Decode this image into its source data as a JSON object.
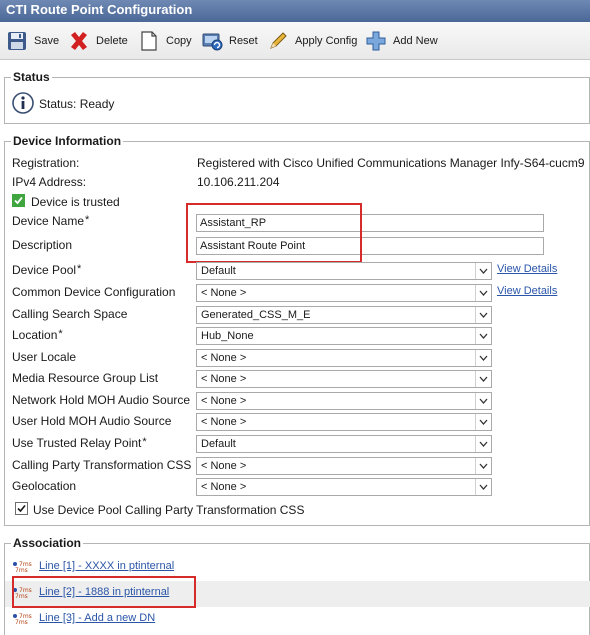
{
  "window": {
    "title": "CTI Route Point Configuration"
  },
  "toolbar": {
    "save": "Save",
    "delete": "Delete",
    "copy": "Copy",
    "reset": "Reset",
    "apply_config": "Apply Config",
    "add_new": "Add New"
  },
  "status": {
    "legend": "Status",
    "text": "Status: Ready"
  },
  "device": {
    "legend": "Device Information",
    "registration_label": "Registration:",
    "registration_value": "Registered with Cisco Unified Communications Manager Infy-S64-cucm9",
    "ipv4_label": "IPv4 Address:",
    "ipv4_value": "10.106.211.204",
    "trusted_label": "Device is trusted",
    "name_label": "Device Name",
    "name_value": "Assistant_RP",
    "description_label": "Description",
    "description_value": "Assistant Route Point",
    "fields": [
      {
        "label": "Device Pool",
        "required": "*",
        "value": "Default",
        "details": "View Details"
      },
      {
        "label": "Common Device Configuration",
        "required": "",
        "value": "< None >",
        "details": "View Details"
      },
      {
        "label": "Calling Search Space",
        "required": "",
        "value": "Generated_CSS_M_E",
        "details": ""
      },
      {
        "label": "Location",
        "required": "*",
        "value": "Hub_None",
        "details": ""
      },
      {
        "label": "User Locale",
        "required": "",
        "value": "< None >",
        "details": ""
      },
      {
        "label": "Media Resource Group List",
        "required": "",
        "value": "< None >",
        "details": ""
      },
      {
        "label": "Network Hold MOH Audio Source",
        "required": "",
        "value": "< None >",
        "details": ""
      },
      {
        "label": "User Hold MOH Audio Source",
        "required": "",
        "value": "< None >",
        "details": ""
      },
      {
        "label": "Use Trusted Relay Point",
        "required": "*",
        "value": "Default",
        "details": ""
      },
      {
        "label": "Calling Party Transformation CSS",
        "required": "",
        "value": "< None >",
        "details": ""
      },
      {
        "label": "Geolocation",
        "required": "",
        "value": "< None >",
        "details": ""
      }
    ],
    "use_pool_cpt_label": "Use Device Pool Calling Party Transformation CSS",
    "use_pool_cpt_checked": true
  },
  "association": {
    "legend": "Association",
    "lines": [
      "Line [1] - XXXX in ptinternal",
      "Line [2] - 1888 in ptinternal",
      "Line [3] - Add a new DN"
    ]
  },
  "colors": {
    "titlebar": "#5a76a6",
    "link": "#2a55a8",
    "highlight": "#d62b2b",
    "checkbox": "#3fa53f"
  },
  "icons": {
    "save": "floppy-disk-icon",
    "delete": "red-x-icon",
    "copy": "document-copy-icon",
    "reset": "reset-icon",
    "apply_config": "pencil-icon",
    "add_new": "plus-icon",
    "status": "info-icon",
    "line": "line-phone-icon"
  }
}
